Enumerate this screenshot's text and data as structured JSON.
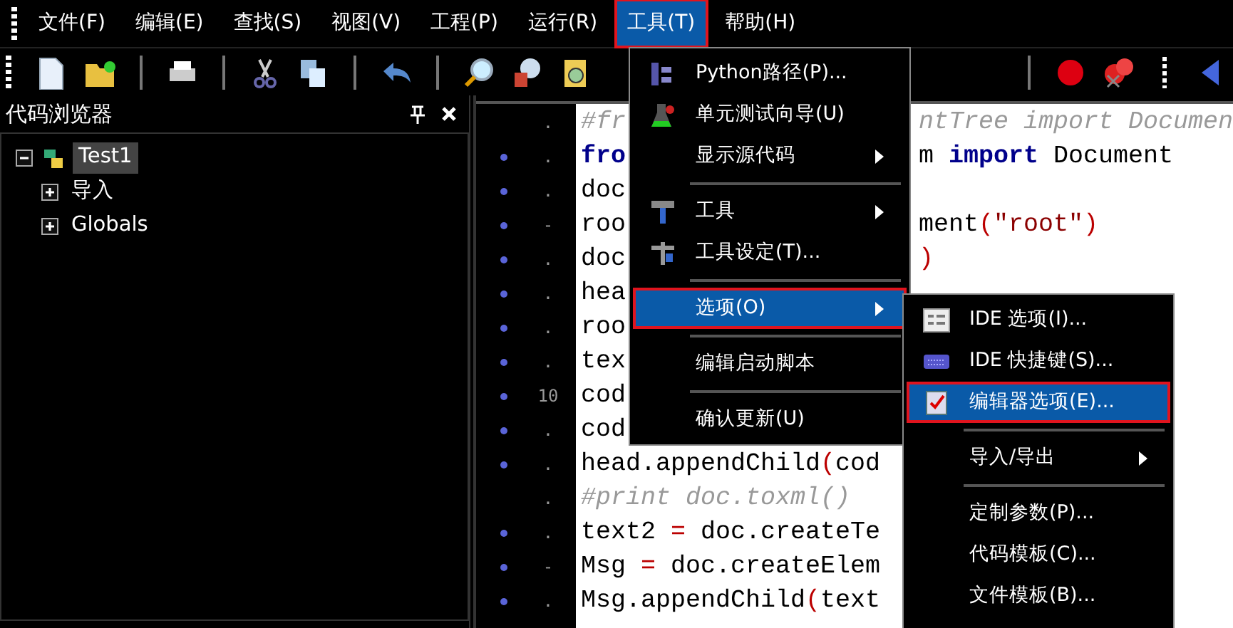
{
  "menubar": [
    {
      "label": "文件(F)",
      "selected": false,
      "outlined": false
    },
    {
      "label": "编辑(E)",
      "selected": false,
      "outlined": false
    },
    {
      "label": "查找(S)",
      "selected": false,
      "outlined": false
    },
    {
      "label": "视图(V)",
      "selected": false,
      "outlined": false
    },
    {
      "label": "工程(P)",
      "selected": false,
      "outlined": false
    },
    {
      "label": "运行(R)",
      "selected": false,
      "outlined": false
    },
    {
      "label": "工具(T)",
      "selected": true,
      "outlined": true
    },
    {
      "label": "帮助(H)",
      "selected": false,
      "outlined": false
    }
  ],
  "code_browser": {
    "title": "代码浏览器",
    "tree": [
      {
        "label": "Test1",
        "expanded": true,
        "selected": true,
        "children": [
          {
            "label": "导入",
            "expanded": false,
            "selected": false
          },
          {
            "label": "Globals",
            "expanded": false,
            "selected": false
          }
        ]
      }
    ]
  },
  "editor": {
    "lines": [
      {
        "marker": false,
        "number": ".",
        "left": [
          {
            "text": "#fr",
            "kind": "comment"
          }
        ],
        "right": [
          {
            "text": "ntTree import Documen",
            "kind": "comment"
          }
        ]
      },
      {
        "marker": true,
        "number": ".",
        "left": [
          {
            "text": "fro",
            "kind": "keyword"
          }
        ],
        "right": [
          {
            "text": "m ",
            "kind": "plain"
          },
          {
            "text": "import",
            "kind": "keyword"
          },
          {
            "text": " Document",
            "kind": "plain"
          }
        ]
      },
      {
        "marker": true,
        "number": ".",
        "left": [
          {
            "text": "doc",
            "kind": "plain"
          }
        ]
      },
      {
        "marker": true,
        "number": "-",
        "left": [
          {
            "text": "roo",
            "kind": "plain"
          }
        ],
        "right": [
          {
            "text": "ment",
            "kind": "plain"
          },
          {
            "text": "(",
            "kind": "paren"
          },
          {
            "text": "\"root\"",
            "kind": "string"
          },
          {
            "text": ")",
            "kind": "paren"
          }
        ]
      },
      {
        "marker": true,
        "number": ".",
        "left": [
          {
            "text": "doc",
            "kind": "plain"
          }
        ],
        "right": [
          {
            "text": ")",
            "kind": "paren"
          }
        ]
      },
      {
        "marker": true,
        "number": ".",
        "left": [
          {
            "text": "hea",
            "kind": "plain"
          }
        ]
      },
      {
        "marker": true,
        "number": ".",
        "left": [
          {
            "text": "roo",
            "kind": "plain"
          }
        ]
      },
      {
        "marker": true,
        "number": ".",
        "left": [
          {
            "text": "tex",
            "kind": "plain"
          }
        ]
      },
      {
        "marker": true,
        "number": "10",
        "left": [
          {
            "text": "cod",
            "kind": "plain"
          }
        ]
      },
      {
        "marker": true,
        "number": ".",
        "left": [
          {
            "text": "cod",
            "kind": "plain"
          }
        ]
      },
      {
        "marker": true,
        "number": ".",
        "left": [
          {
            "text": "head.appendChild",
            "kind": "plain"
          },
          {
            "text": "(",
            "kind": "paren"
          },
          {
            "text": "cod",
            "kind": "plain"
          }
        ]
      },
      {
        "marker": false,
        "number": ".",
        "left": [
          {
            "text": "#print doc.toxml()",
            "kind": "comment"
          }
        ]
      },
      {
        "marker": true,
        "number": ".",
        "left": [
          {
            "text": "text2 ",
            "kind": "plain"
          },
          {
            "text": "=",
            "kind": "paren"
          },
          {
            "text": " doc.createTe",
            "kind": "plain"
          }
        ]
      },
      {
        "marker": true,
        "number": "-",
        "left": [
          {
            "text": "Msg ",
            "kind": "plain"
          },
          {
            "text": "=",
            "kind": "paren"
          },
          {
            "text": " doc.createElem",
            "kind": "plain"
          }
        ]
      },
      {
        "marker": true,
        "number": ".",
        "left": [
          {
            "text": "Msg.appendChild",
            "kind": "plain"
          },
          {
            "text": "(",
            "kind": "paren"
          },
          {
            "text": "text",
            "kind": "plain"
          }
        ]
      }
    ]
  },
  "tools_menu": [
    {
      "kind": "item",
      "label": "Python路径(P)...",
      "submenu": false,
      "selected": false,
      "outlined": false
    },
    {
      "kind": "item",
      "label": "单元测试向导(U)",
      "submenu": false,
      "selected": false,
      "outlined": false
    },
    {
      "kind": "item",
      "label": "显示源代码",
      "submenu": true,
      "selected": false,
      "outlined": false
    },
    {
      "kind": "separator"
    },
    {
      "kind": "item",
      "label": "工具",
      "submenu": true,
      "selected": false,
      "outlined": false
    },
    {
      "kind": "item",
      "label": "工具设定(T)...",
      "submenu": false,
      "selected": false,
      "outlined": false
    },
    {
      "kind": "separator"
    },
    {
      "kind": "item",
      "label": "选项(O)",
      "submenu": true,
      "selected": true,
      "outlined": true
    },
    {
      "kind": "separator"
    },
    {
      "kind": "item",
      "label": "编辑启动脚本",
      "submenu": false,
      "selected": false,
      "outlined": false
    },
    {
      "kind": "separator"
    },
    {
      "kind": "item",
      "label": "确认更新(U)",
      "submenu": false,
      "selected": false,
      "outlined": false
    }
  ],
  "options_submenu": [
    {
      "kind": "item",
      "label": "IDE 选项(I)...",
      "submenu": false,
      "selected": false,
      "outlined": false
    },
    {
      "kind": "item",
      "label": "IDE 快捷键(S)...",
      "submenu": false,
      "selected": false,
      "outlined": false
    },
    {
      "kind": "item",
      "label": "编辑器选项(E)...",
      "submenu": false,
      "selected": true,
      "outlined": true
    },
    {
      "kind": "separator"
    },
    {
      "kind": "item",
      "label": "导入/导出",
      "submenu": true,
      "selected": false,
      "outlined": false
    },
    {
      "kind": "separator"
    },
    {
      "kind": "item",
      "label": "定制参数(P)...",
      "submenu": false,
      "selected": false,
      "outlined": false
    },
    {
      "kind": "item",
      "label": "代码模板(C)...",
      "submenu": false,
      "selected": false,
      "outlined": false
    },
    {
      "kind": "item",
      "label": "文件模板(B)...",
      "submenu": false,
      "selected": false,
      "outlined": false
    }
  ]
}
